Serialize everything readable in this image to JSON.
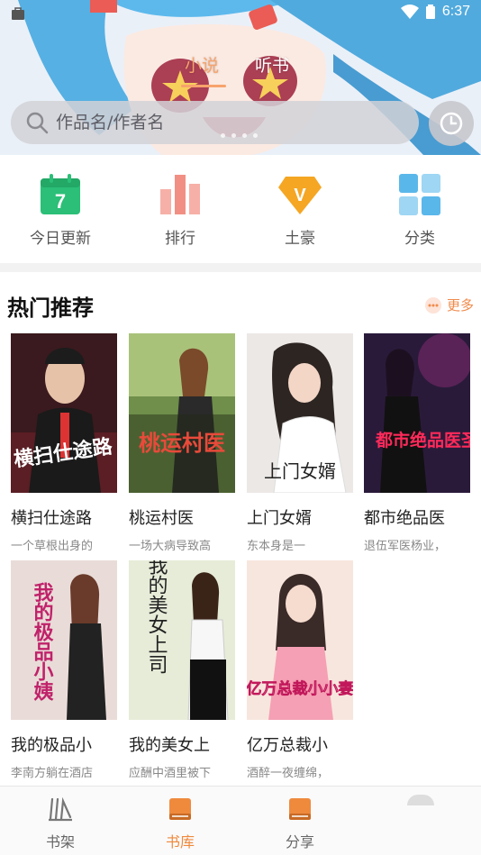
{
  "status_bar": {
    "time": "6:37"
  },
  "header": {
    "tabs": [
      {
        "label": "小说",
        "active": true
      },
      {
        "label": "听书",
        "active": false
      }
    ],
    "search": {
      "placeholder": "作品名/作者名"
    },
    "banner_page_count": 4
  },
  "quick_entries": [
    {
      "label": "今日更新",
      "icon": "calendar-icon",
      "badge": "7",
      "color": "#2bbf77"
    },
    {
      "label": "排行",
      "icon": "ranking-bars-icon",
      "color": "#f59a8f"
    },
    {
      "label": "土豪",
      "icon": "vip-diamond-icon",
      "badge": "V",
      "color": "#f5a623"
    },
    {
      "label": "分类",
      "icon": "category-grid-icon",
      "color": "#5ab7ea"
    }
  ],
  "hot": {
    "title": "热门推荐",
    "more_label": "更多",
    "books": [
      {
        "title": "横扫仕途路",
        "desc": "一个草根出身的",
        "cover_text": "横扫仕途路"
      },
      {
        "title": "桃运村医",
        "desc": "一场大病导致高",
        "cover_text": "桃运村医"
      },
      {
        "title": "上门女婿",
        "desc": "东本身是一",
        "cover_text": "上门女婿"
      },
      {
        "title": "都市绝品医",
        "desc": "退伍军医杨业，",
        "cover_text": "都市绝品医圣"
      },
      {
        "title": "我的极品小",
        "desc": "李南方躺在酒店",
        "cover_text": "我的极品小姨"
      },
      {
        "title": "我的美女上",
        "desc": "应酬中酒里被下",
        "cover_text": "我的美女上司"
      },
      {
        "title": "亿万总裁小",
        "desc": "酒醉一夜缠绵，",
        "cover_text": "亿万总裁小小妻"
      }
    ]
  },
  "bottom_nav": [
    {
      "label": "书架",
      "icon": "bookshelf-icon",
      "active": false
    },
    {
      "label": "书库",
      "icon": "library-book-icon",
      "active": true
    },
    {
      "label": "分享",
      "icon": "share-book-icon",
      "active": false
    }
  ],
  "colors": {
    "accent": "#ef8a3d",
    "tab_active": "#f7a36c"
  }
}
